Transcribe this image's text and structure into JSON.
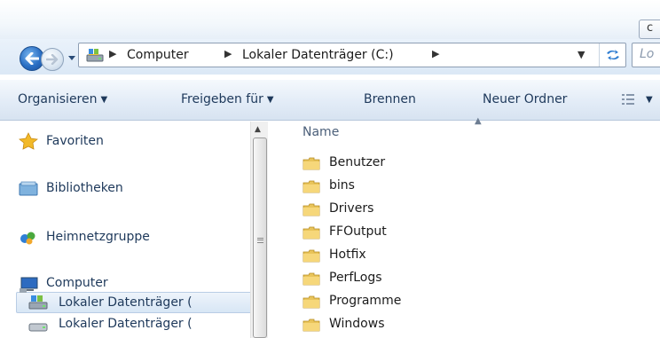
{
  "window": {
    "caption_button_glyph": "c"
  },
  "address_bar": {
    "breadcrumbs": [
      "Computer",
      "Lokaler Datenträger (C:)"
    ],
    "search_placeholder": "Lo",
    "location_icon": "drive-icon"
  },
  "toolbar": {
    "organize_label": "Organisieren",
    "share_label": "Freigeben für",
    "burn_label": "Brennen",
    "new_folder_label": "Neuer Ordner",
    "views_icon": "details-view-icon"
  },
  "nav_pane": {
    "items": [
      {
        "label": "Favoriten",
        "icon": "star-icon"
      },
      {
        "label": "Bibliotheken",
        "icon": "library-icon"
      },
      {
        "label": "Heimnetzgruppe",
        "icon": "homegroup-icon"
      },
      {
        "label": "Computer",
        "icon": "computer-icon"
      },
      {
        "label": "Lokaler Datenträger (",
        "icon": "drive-icon",
        "selected": true
      },
      {
        "label": "Lokaler Datenträger (",
        "icon": "drive-icon"
      }
    ]
  },
  "content": {
    "column_header": "Name",
    "folders": [
      "Benutzer",
      "bins",
      "Drivers",
      "FFOutput",
      "Hotfix",
      "PerfLogs",
      "Programme",
      "Windows"
    ]
  },
  "colors": {
    "accent": "#1e395b",
    "folder": "#e9c45a",
    "selection": "#d8e6f5"
  }
}
